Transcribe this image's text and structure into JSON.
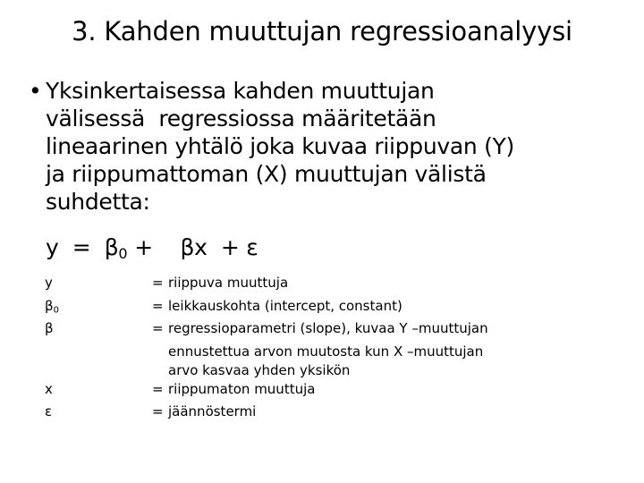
{
  "slide": {
    "title": "3. Kahden muuttujan regressioanalyysi",
    "bullet": {
      "marker": "bullet-dot",
      "lines": [
        "Yksinkertaisessa kahden muuttujan",
        "välisessä  regressiossa määritetään",
        "lineaarinen yhtälö joka kuvaa riippuvan (Y)",
        "ja riippumattoman (X) muuttujan välistä",
        "suhdetta:"
      ]
    },
    "equation": {
      "lhs": "y  =  ",
      "beta0": "β",
      "beta0_sub": "0",
      "plus1": " +    ",
      "beta": "β",
      "x": "x",
      "plus2": "  + ",
      "epsilon": "ε"
    },
    "definitions": [
      {
        "symbol": "y",
        "symbol_sub": "",
        "equals": "=",
        "value": "riippuva muuttuja",
        "continuations": []
      },
      {
        "symbol": "β",
        "symbol_sub": "0",
        "equals": "=",
        "value": "leikkauskohta (intercept, constant)",
        "continuations": []
      },
      {
        "symbol": "β",
        "symbol_sub": "",
        "equals": "=",
        "value": "regressioparametri (slope), kuvaa Y –muuttujan",
        "continuations": [
          "ennustettua arvon muutosta kun X –muuttujan",
          "arvo kasvaa yhden yksikön"
        ]
      },
      {
        "symbol": "x",
        "symbol_sub": "",
        "equals": "=",
        "value": "riippumaton muuttuja",
        "continuations": []
      },
      {
        "symbol": "ε",
        "symbol_sub": "",
        "equals": "=",
        "value": "jäännöstermi",
        "continuations": []
      }
    ]
  },
  "colors": {
    "background": "#ffffff",
    "text": "#000000"
  }
}
